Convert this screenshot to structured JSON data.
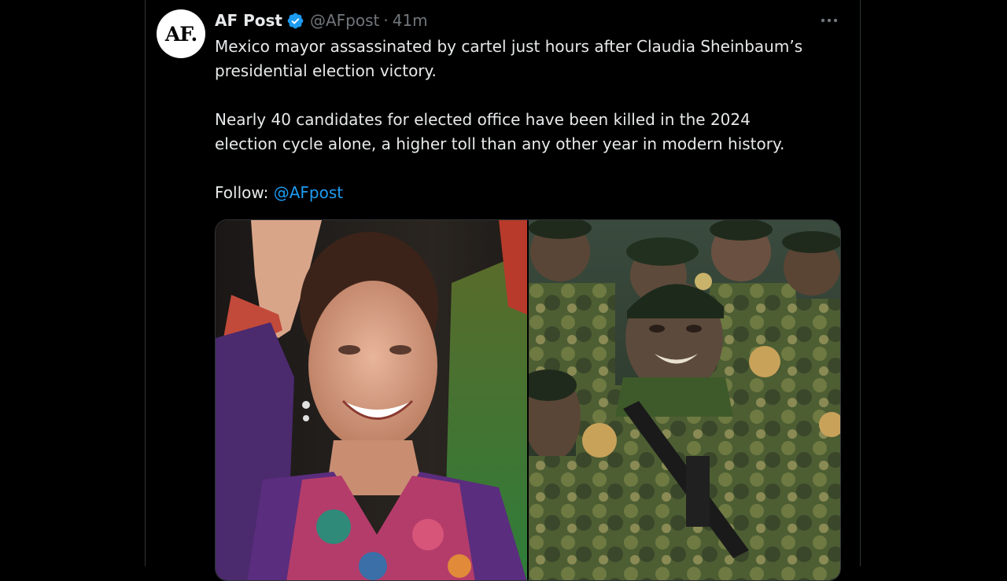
{
  "tweet": {
    "avatar_text": "AF.",
    "display_name": "AF Post",
    "handle": "@AFpost",
    "separator": "·",
    "time": "41m",
    "more_icon": "more-horizontal-icon",
    "body": {
      "paragraph1_line1": "Mexico mayor assassinated by cartel just hours after Claudia Sheinbaum’s",
      "paragraph1_line2": "presidential election victory.",
      "paragraph2_line1": "Nearly 40 candidates for elected office have been killed in the 2024",
      "paragraph2_line2": "election cycle alone, a higher toll than any other year in modern history.",
      "follow_label": "Follow:",
      "follow_mention": "@AFpost"
    },
    "media": {
      "left_photo": "photo-woman-waving",
      "right_photo": "photo-soldiers-marching"
    }
  },
  "colors": {
    "background": "#000000",
    "text_primary": "#e7e9ea",
    "text_secondary": "#71767b",
    "link": "#1d9bf0",
    "verified": "#1d9bf0",
    "border": "#2f3336"
  }
}
